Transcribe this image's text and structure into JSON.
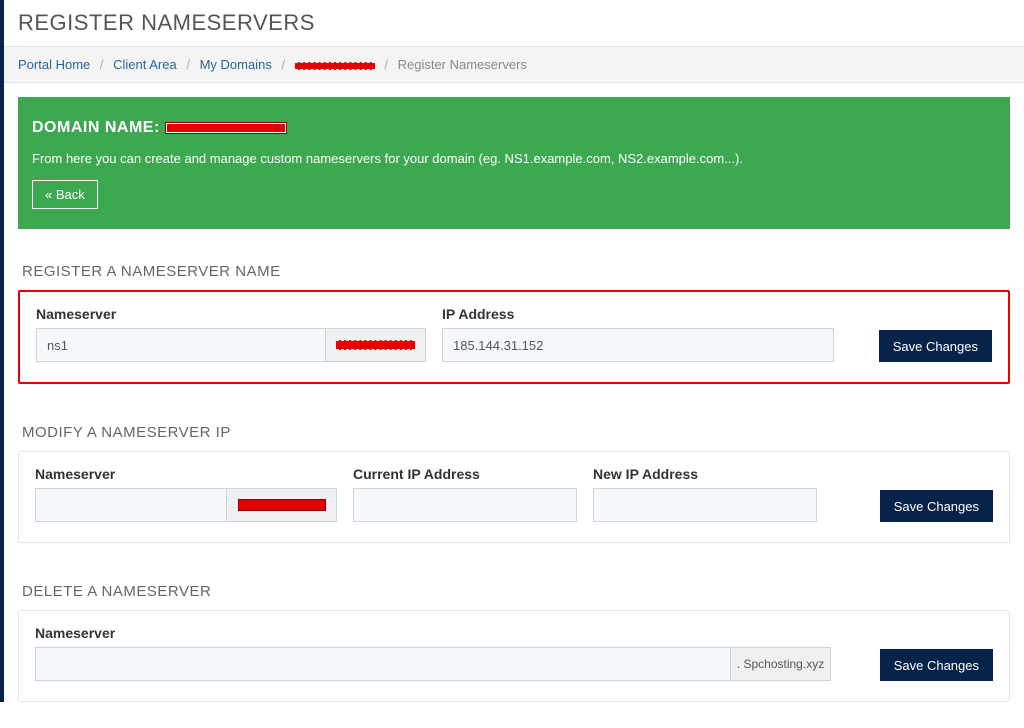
{
  "page_title": "REGISTER NAMESERVERS",
  "breadcrumb": {
    "portal_home": "Portal Home",
    "client_area": "Client Area",
    "my_domains": "My Domains",
    "current": "Register Nameservers"
  },
  "banner": {
    "prefix": "DOMAIN NAME: ",
    "description": "From here you can create and manage custom nameservers for your domain (eg. NS1.example.com, NS2.example.com...).",
    "back_label": "« Back"
  },
  "register": {
    "heading": "REGISTER A NAMESERVER NAME",
    "nameserver_label": "Nameserver",
    "nameserver_value": "ns1",
    "ip_label": "IP Address",
    "ip_value": "185.144.31.152",
    "save_label": "Save Changes"
  },
  "modify": {
    "heading": "MODIFY A NAMESERVER IP",
    "nameserver_label": "Nameserver",
    "nameserver_value": "",
    "current_ip_label": "Current IP Address",
    "current_ip_value": "",
    "new_ip_label": "New IP Address",
    "new_ip_value": "",
    "save_label": "Save Changes"
  },
  "del": {
    "heading": "DELETE A NAMESERVER",
    "nameserver_label": "Nameserver",
    "nameserver_value": "",
    "domain_suffix": ". Spchosting.xyz",
    "save_label": "Save Changes"
  }
}
